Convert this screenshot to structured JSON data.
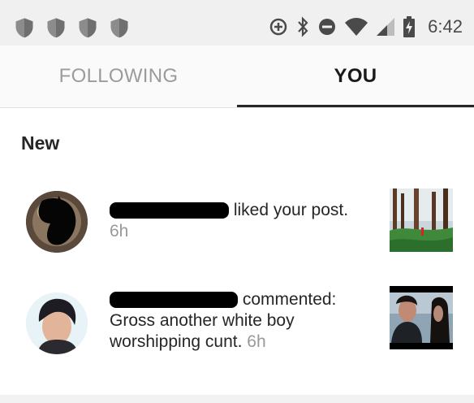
{
  "status_bar": {
    "time": "6:42",
    "left_icons": [
      "shield-icon",
      "shield-icon",
      "shield-icon",
      "shield-icon"
    ],
    "right_icons": [
      "data-saver-icon",
      "bluetooth-icon",
      "do-not-disturb-icon",
      "wifi-icon",
      "cell-signal-icon",
      "battery-charging-icon"
    ]
  },
  "tabs": [
    {
      "label": "FOLLOWING",
      "selected": false
    },
    {
      "label": "YOU",
      "selected": true
    }
  ],
  "section_title": "New",
  "notifications": [
    {
      "text": "liked your post.",
      "time": "6h"
    },
    {
      "text_line1": "commented:",
      "text_rest": "Gross another white boy worshipping cunt.",
      "time": "6h"
    }
  ],
  "colors": {
    "status_bar_bg": "#f0f0f0",
    "tab_inactive": "#9b9b9b",
    "tab_active": "#1a1a1a",
    "timestamp": "#999999"
  }
}
